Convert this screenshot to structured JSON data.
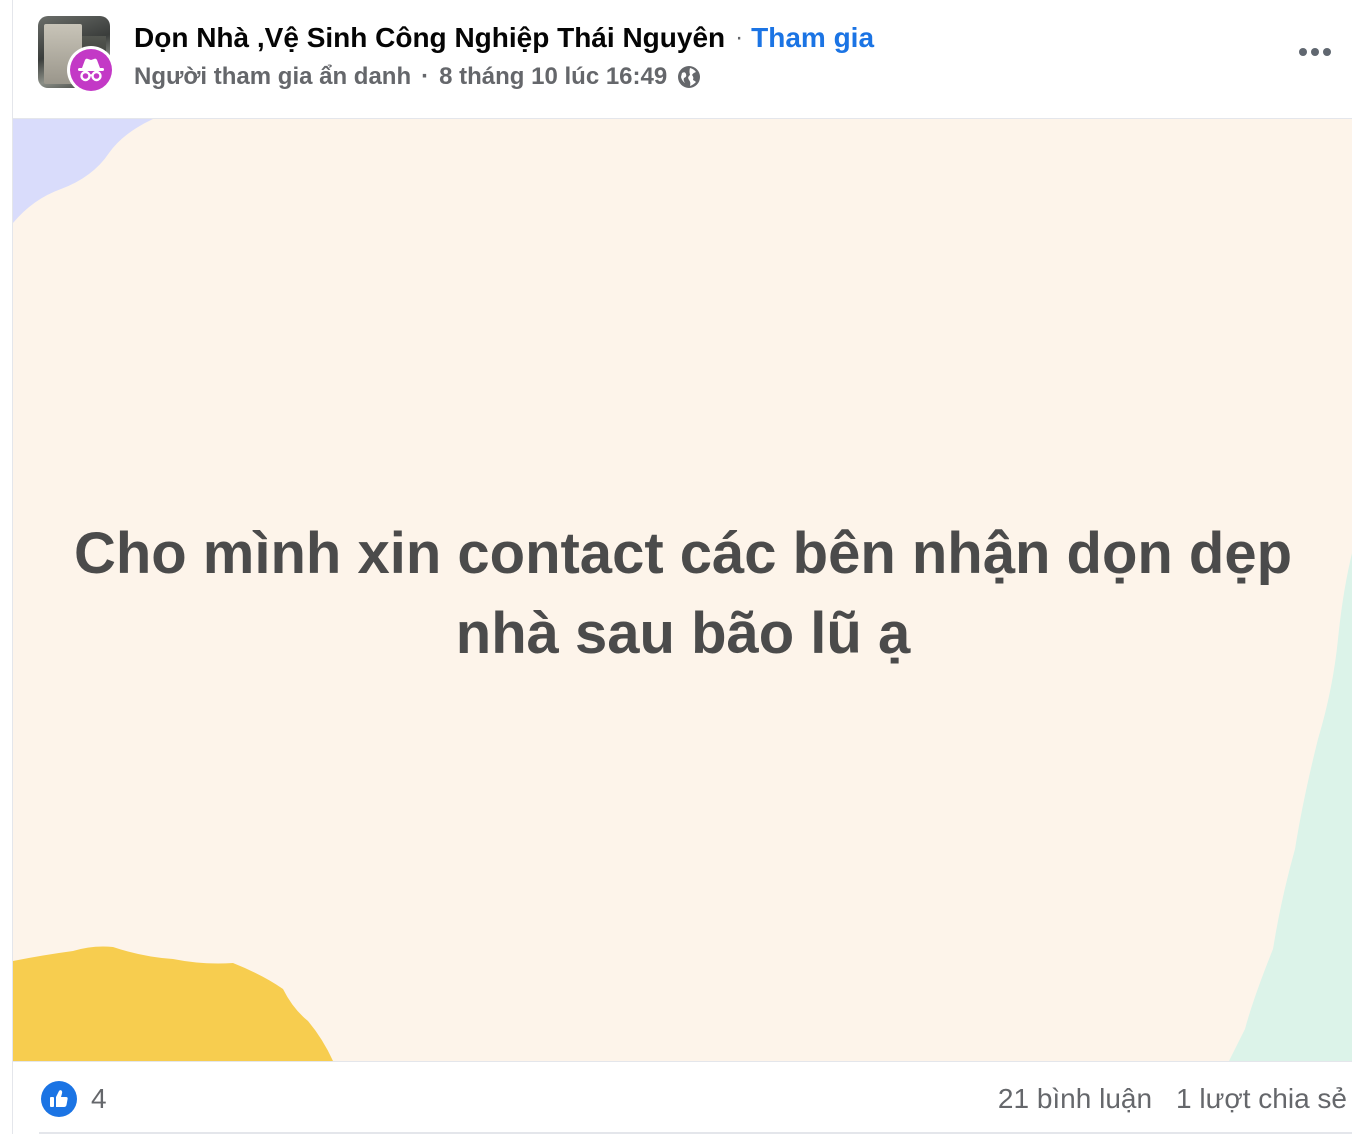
{
  "header": {
    "group_name": "Dọn Nhà ,Vệ Sinh Công Nghiệp Thái Nguyên",
    "separator": "·",
    "join_label": "Tham gia",
    "author": "Người tham gia ẩn danh",
    "meta_separator": "·",
    "timestamp": "8 tháng 10 lúc 16:49",
    "privacy_icon": "globe-icon",
    "more_icon": "more-options-icon"
  },
  "post": {
    "text": "Cho mình xin contact các bên nhận dọn dẹp nhà sau bão lũ ạ",
    "background_color": "#fdf4ea",
    "text_color": "#4b4b4b"
  },
  "footer": {
    "reaction_icon": "like-icon",
    "like_count": "4",
    "comments": "21 bình luận",
    "shares": "1 lượt chia sẻ"
  },
  "colors": {
    "accent": "#1b74e4",
    "anonymous_avatar": "#c339c6",
    "blob_purple": "#d9dcfb",
    "blob_yellow": "#f7cd4f",
    "blob_mint": "#dcf3e9"
  }
}
